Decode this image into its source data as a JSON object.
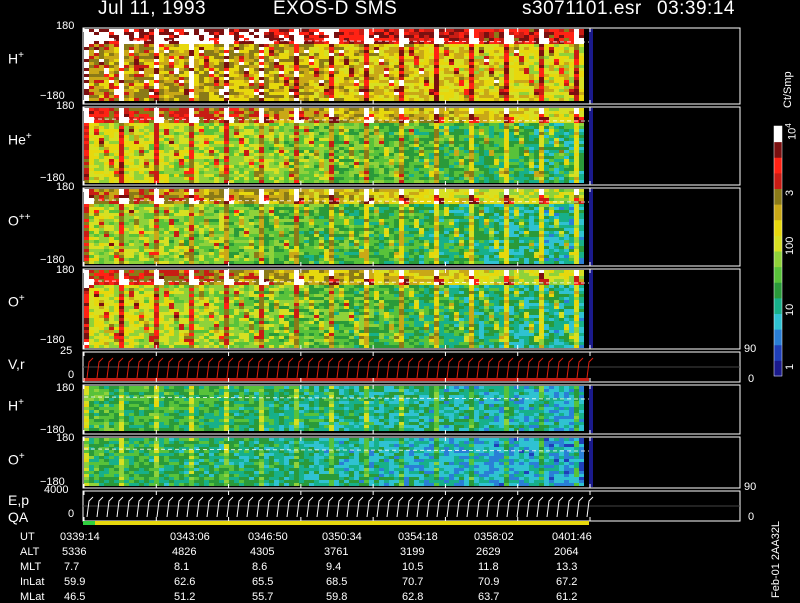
{
  "header": {
    "date": "Jul 11, 1993",
    "instrument": "EXOS-D SMS",
    "file": "s3071101.esr",
    "time": "03:39:14"
  },
  "colors": {
    "background": "#000000",
    "text": "#ffffff",
    "colormap": [
      "#1a1a8c",
      "#1f3fb8",
      "#2a7fd6",
      "#2fc2d2",
      "#17b08a",
      "#2a9a3a",
      "#58c23a",
      "#8fd23a",
      "#d7e022",
      "#e7d80d",
      "#c9a817",
      "#8a7a18",
      "#c81c14",
      "#ff2214",
      "#7a1010",
      "#ffffff"
    ]
  },
  "colorbar": {
    "unit": "Ct/Smp",
    "labels": [
      "10",
      "3",
      "10",
      "100",
      "10",
      "1"
    ],
    "exponents": [
      "4",
      "",
      "",
      "",
      "",
      ""
    ]
  },
  "panels": [
    {
      "id": "h-plus",
      "label": "H",
      "sup": "+",
      "ymax": "180",
      "ymin": "−180"
    },
    {
      "id": "he-plus",
      "label": "He",
      "sup": "+",
      "ymax": "180",
      "ymin": "−180"
    },
    {
      "id": "o-plus-plus",
      "label": "O",
      "sup": "++",
      "ymax": "180",
      "ymin": "−180"
    },
    {
      "id": "o-plus",
      "label": "O",
      "sup": "+",
      "ymax": "180",
      "ymin": "−180"
    },
    {
      "id": "v-r",
      "label": "V,r",
      "sup": "",
      "ymax": "25",
      "ymin": "0",
      "rmax": "90",
      "rmin": "0"
    },
    {
      "id": "h-plus-2",
      "label": "H",
      "sup": "+",
      "ymax": "180",
      "ymin": "−180"
    },
    {
      "id": "o-plus-2",
      "label": "O",
      "sup": "+",
      "ymax": "180",
      "ymin": "−180"
    },
    {
      "id": "e-p",
      "label": "E,p",
      "sup": "",
      "ymax": "4000",
      "ymin": "0",
      "rmax": "90",
      "rmin": "0"
    }
  ],
  "qa_label": "QA",
  "chart_data": {
    "type": "heatmap",
    "title": "Jul 11, 1993   EXOS-D SMS",
    "xlabel": "UT",
    "color_scale": "log",
    "color_unit": "Ct/Smp",
    "color_range": [
      1,
      10000
    ],
    "ephemeris": {
      "rows": [
        "UT",
        "ALT",
        "MLT",
        "InLat",
        "MLat"
      ],
      "UT": [
        "0339:14",
        "0343:06",
        "0346:50",
        "0350:34",
        "0354:18",
        "0358:02",
        "0401:46"
      ],
      "ALT": [
        "5336",
        "4826",
        "4305",
        "3761",
        "3199",
        "2629",
        "2064"
      ],
      "MLT": [
        "7.7",
        "8.1",
        "8.6",
        "9.4",
        "10.5",
        "11.8",
        "13.3"
      ],
      "InLat": [
        "59.9",
        "62.6",
        "65.5",
        "68.5",
        "70.7",
        "70.9",
        "67.2"
      ],
      "MLat": [
        "46.5",
        "51.2",
        "55.7",
        "59.8",
        "62.8",
        "63.7",
        "61.2"
      ]
    }
  },
  "footer_note": "Feb-01 2AA32L"
}
